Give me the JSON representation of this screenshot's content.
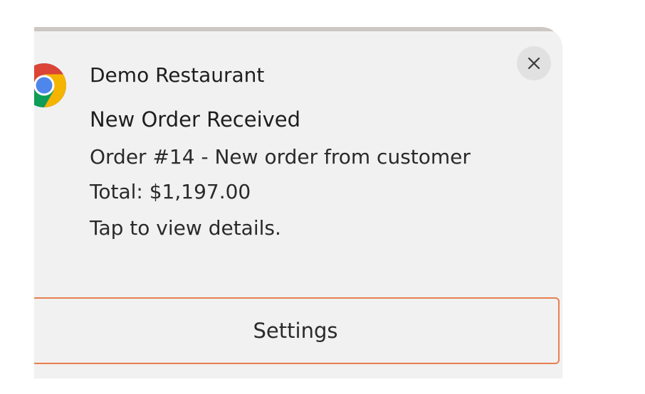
{
  "notification": {
    "app_name": "Demo Restaurant",
    "app_icon": "chrome-icon",
    "close_icon": "close-icon",
    "title": "New Order Received",
    "body_lines": [
      "Order #14 - New order from customer",
      "Total: $1,197.00",
      "Tap to view details."
    ],
    "action_label": "Settings"
  },
  "colors": {
    "background": "#f1f1f1",
    "accent_border": "#e87f4f",
    "close_button_bg": "#e1e1e1",
    "text": "#1e1e1e"
  }
}
